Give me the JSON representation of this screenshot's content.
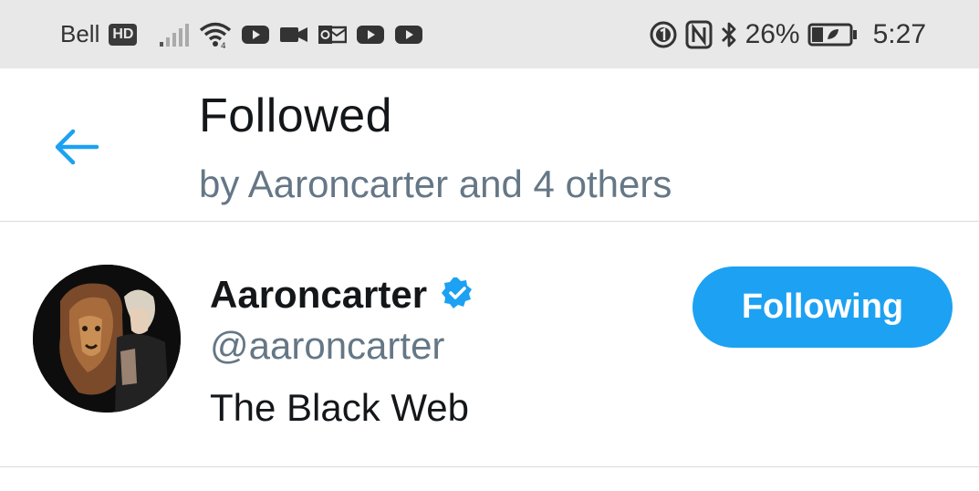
{
  "status_bar": {
    "carrier": "Bell",
    "network_badge": "HD",
    "battery_percent": "26%",
    "time": "5:27",
    "icons": [
      "signal-icon",
      "wifi-icon",
      "youtube-icon",
      "video-camera-icon",
      "outlook-icon",
      "youtube-icon",
      "youtube-icon",
      "data-saver-icon",
      "nfc-icon",
      "bluetooth-icon",
      "battery-icon"
    ]
  },
  "header": {
    "back_icon": "back-arrow-icon",
    "title": "Followed",
    "subtitle": "by Aaroncarter and 4 others"
  },
  "users": [
    {
      "display_name": "Aaroncarter",
      "verified": true,
      "handle": "@aaroncarter",
      "bio": "The Black Web",
      "follow_button_label": "Following"
    }
  ],
  "colors": {
    "accent": "#1da1f2",
    "secondary_text": "#657786",
    "primary_text": "#14171a",
    "status_bar_bg": "#e8e8e8"
  }
}
